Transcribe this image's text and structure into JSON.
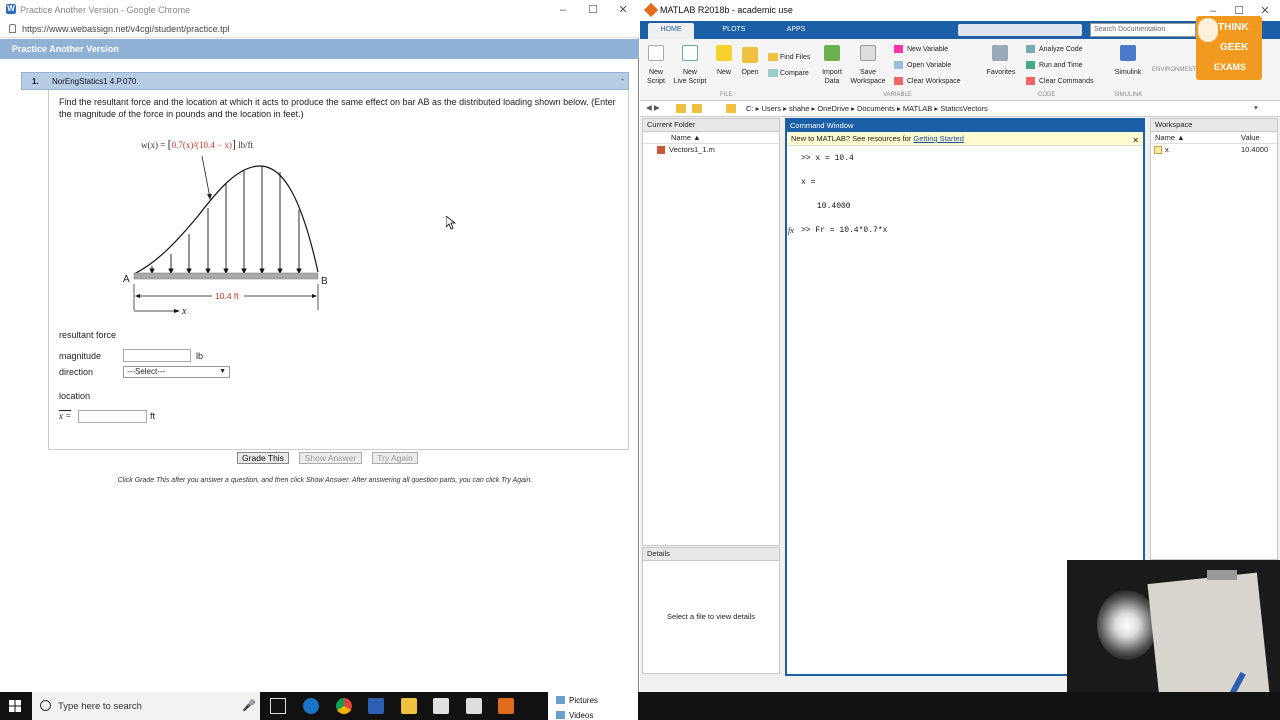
{
  "chrome": {
    "title": "Practice Another Version - Google Chrome",
    "url": "https://www.webassign.net/v4cgi/student/practice.tpl",
    "header": "Practice Another Version"
  },
  "question": {
    "number": "1.",
    "name": "NorEngStatics1 4.P.070.",
    "collapse": "-",
    "text": "Find the resultant force and the location at which it acts to produce the same effect on bar AB as the distributed loading shown below. (Enter the magnitude of the force in pounds and the location in feet.)",
    "formula_lhs": "w(x) = ",
    "formula_red": "0.7(x)²(10.4 − x)",
    "formula_unit": "lb/ft",
    "point_a": "A",
    "point_b": "B",
    "length_label": "10.4 ft",
    "x_label": "x",
    "resultant_label": "resultant force",
    "magnitude_label": "magnitude",
    "magnitude_value": "",
    "magnitude_unit": "lb",
    "direction_label": "direction",
    "direction_value": "---Select---",
    "location_label": "location",
    "xbar_label": "x =",
    "location_value": "",
    "location_unit": "ft",
    "buttons": {
      "grade": "Grade This",
      "show": "Show Answer",
      "again": "Try Again"
    },
    "hint": "Click Grade This after you answer a question, and then click Show Answer. After answering all question parts, you can click Try Again."
  },
  "matlab": {
    "title": "MATLAB R2018b - academic use",
    "tabs": [
      "HOME",
      "PLOTS",
      "APPS"
    ],
    "search_placeholder": "Search Documentation",
    "ribbon": {
      "new_script": "New\nScript",
      "new_live_script": "New\nLive Script",
      "new": "New",
      "open": "Open",
      "find_files": "Find Files",
      "compare": "Compare",
      "import_data": "Import\nData",
      "save_workspace": "Save\nWorkspace",
      "new_variable": "New Variable",
      "open_variable": "Open Variable",
      "clear_workspace": "Clear Workspace",
      "favorites": "Favorites",
      "analyze_code": "Analyze Code",
      "run_and_time": "Run and Time",
      "clear_commands": "Clear Commands",
      "simulink": "Simulink",
      "environment": "ENVIRONMENT",
      "groups": [
        "FILE",
        "VARIABLE",
        "CODE",
        "SIMULINK"
      ]
    },
    "path": [
      "C:",
      "Users",
      "shahe",
      "OneDrive",
      "Documents",
      "MATLAB",
      "StaticsVectors"
    ],
    "current_folder": {
      "title": "Current Folder",
      "col_name": "Name ▲",
      "files": [
        "Vectors1_1.m"
      ]
    },
    "details": {
      "title": "Details",
      "empty": "Select a file to view details"
    },
    "command_window": {
      "title": "Command Window",
      "notice": "New to MATLAB? See resources for ",
      "notice_link": "Getting Started",
      "lines": [
        ">> x = 10.4",
        "x =",
        "10.4000"
      ],
      "prompt": ">> Fr = 10.4*0.7*x",
      "fx": "fx"
    },
    "workspace": {
      "title": "Workspace",
      "col_name": "Name ▲",
      "col_value": "Value",
      "rows": [
        {
          "name": "x",
          "value": "10.4000"
        }
      ]
    }
  },
  "logo": {
    "line1": "THINK",
    "line2": "GEEK",
    "line3": "EXAMS"
  },
  "taskbar": {
    "search": "Type here to search",
    "tray_items": [
      "Pictures",
      "Videos"
    ]
  },
  "colors": {
    "matlab_blue": "#1b5fa6",
    "webassign_header": "#8fb1d6",
    "formula_red": "#c0392b"
  }
}
